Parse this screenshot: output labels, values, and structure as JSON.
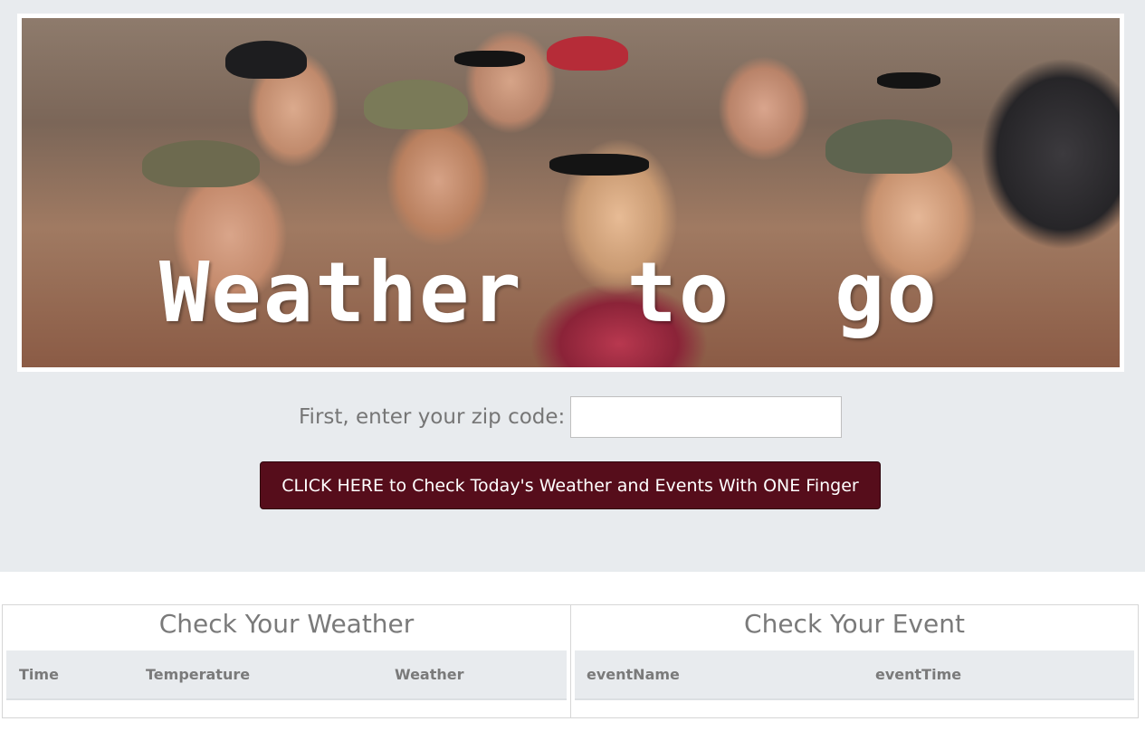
{
  "banner": {
    "title": "Weather  to  go",
    "image": "crowd-photo"
  },
  "zip": {
    "label": "First, enter your zip code:",
    "value": "",
    "placeholder": ""
  },
  "cta": {
    "label": "CLICK HERE to Check Today's Weather and Events With ONE Finger",
    "color": "#560d1b"
  },
  "weather_panel": {
    "title": "Check Your Weather",
    "columns": [
      "Time",
      "Temperature",
      "Weather"
    ],
    "rows": []
  },
  "event_panel": {
    "title": "Check Your Event",
    "columns": [
      "eventName",
      "eventTime"
    ],
    "rows": []
  },
  "colors": {
    "jumbotron_bg": "#e8ebee",
    "muted_text": "#767676"
  }
}
